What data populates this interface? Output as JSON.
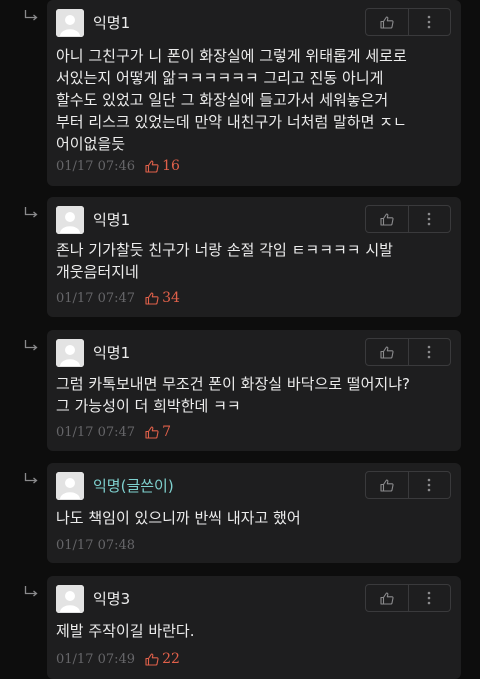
{
  "colors": {
    "background": "#0d0d0d",
    "card": "#1e1e1f",
    "text": "#ececec",
    "meta": "#666669",
    "likes": "#e0604a",
    "op_author": "#7fd1cf"
  },
  "icons": {
    "reply": "reply-arrow-icon",
    "avatar": "default-user-avatar-icon",
    "like": "thumbs-up-icon",
    "more": "more-vertical-icon"
  },
  "comments": [
    {
      "author": "익명1",
      "is_op": false,
      "text": "아니 그친구가 니 폰이 화장실에 그렇게 위태롭게 세로로\n서있는지 어떻게 앎ㅋㅋㅋㅋㅋㅋ 그리고 진동 아니게\n할수도 있었고 일단 그 화장실에 들고가서 세워놓은거\n부터 리스크 있었는데 만약 내친구가 너처럼 말하면 ㅈㄴ\n어이없을듯",
      "time": "01/17 07:46",
      "likes": "16"
    },
    {
      "author": "익명1",
      "is_op": false,
      "text": "존나 기가찰듯 친구가 너랑 손절 각임 ㅌㅋㅋㅋㅋ 시발\n개웃음터지네",
      "time": "01/17 07:47",
      "likes": "34"
    },
    {
      "author": "익명1",
      "is_op": false,
      "text": "그럼 카톡보내면 무조건 폰이 화장실 바닥으로 떨어지냐?\n그 가능성이 더 희박한데 ㅋㅋ",
      "time": "01/17 07:47",
      "likes": "7"
    },
    {
      "author": "익명(글쓴이)",
      "is_op": true,
      "text": "나도 책임이 있으니까 반씩 내자고 했어",
      "time": "01/17 07:48",
      "likes": ""
    },
    {
      "author": "익명3",
      "is_op": false,
      "text": "제발 주작이길 바란다.",
      "time": "01/17 07:49",
      "likes": "22"
    }
  ]
}
